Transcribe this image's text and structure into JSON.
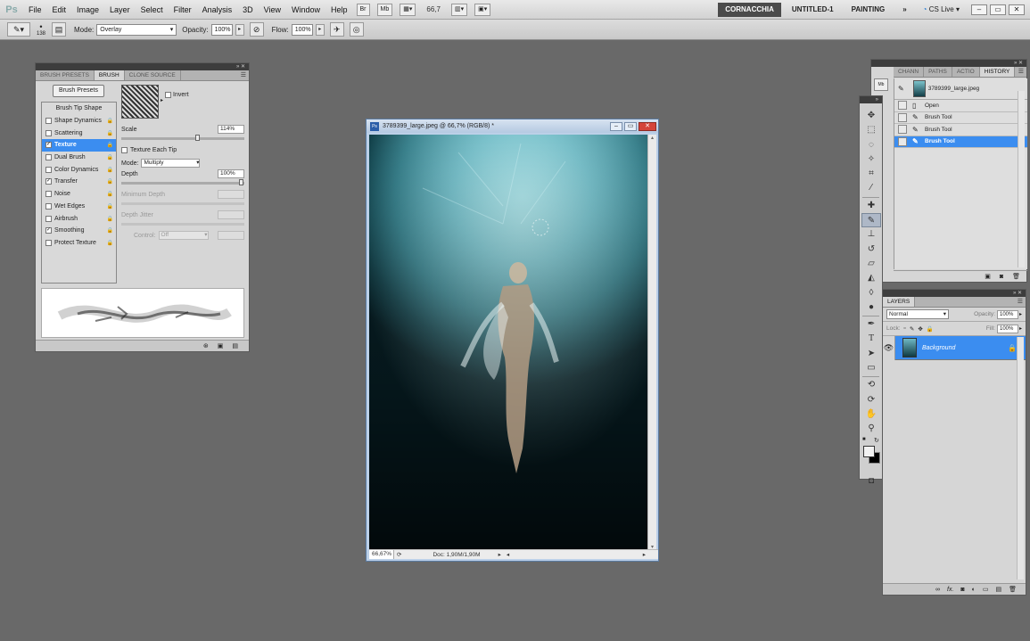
{
  "app": {
    "logo": "Ps"
  },
  "menubar": {
    "items": [
      "File",
      "Edit",
      "Image",
      "Layer",
      "Select",
      "Filter",
      "Analysis",
      "3D",
      "View",
      "Window",
      "Help"
    ],
    "bridge": "Br",
    "minibridge": "Mb",
    "zoom": "66,7",
    "workspaces": [
      "CORNACCHIA",
      "UNTITLED-1",
      "PAINTING"
    ],
    "more": "»",
    "cs_live": "CS Live"
  },
  "optionsbar": {
    "brush_size": "138",
    "mode_label": "Mode:",
    "mode_value": "Overlay",
    "opacity_label": "Opacity:",
    "opacity_value": "100%",
    "flow_label": "Flow:",
    "flow_value": "100%"
  },
  "brush_panel": {
    "tabs": [
      "BRUSH PRESETS",
      "BRUSH",
      "CLONE SOURCE"
    ],
    "presets_button": "Brush Presets",
    "options": [
      {
        "label": "Brush Tip Shape",
        "header": true
      },
      {
        "label": "Shape Dynamics",
        "checked": false
      },
      {
        "label": "Scattering",
        "checked": false
      },
      {
        "label": "Texture",
        "checked": true,
        "selected": true
      },
      {
        "label": "Dual Brush",
        "checked": false
      },
      {
        "label": "Color Dynamics",
        "checked": false
      },
      {
        "label": "Transfer",
        "checked": true
      },
      {
        "label": "Noise",
        "checked": false
      },
      {
        "label": "Wet Edges",
        "checked": false
      },
      {
        "label": "Airbrush",
        "checked": false
      },
      {
        "label": "Smoothing",
        "checked": true
      },
      {
        "label": "Protect Texture",
        "checked": false
      }
    ],
    "invert_label": "Invert",
    "scale_label": "Scale",
    "scale_value": "114%",
    "scale_level": 0.6,
    "texture_each_tip": "Texture Each Tip",
    "mode_label": "Mode:",
    "mode_value": "Multiply",
    "depth_label": "Depth",
    "depth_value": "100%",
    "depth_level": 1.0,
    "min_depth_label": "Minimum Depth",
    "depth_jitter_label": "Depth Jitter",
    "control_label": "Control:",
    "control_value": "Off"
  },
  "document": {
    "title": "3789399_large.jpeg @ 66,7% (RGB/8) *",
    "zoom": "66,67%",
    "doc_info": "Doc: 1,90M/1,90M"
  },
  "history_panel": {
    "tabs": [
      "CHANN",
      "PATHS",
      "ACTIO",
      "HISTORY"
    ],
    "snapshot": "3789399_large.jpeg",
    "states": [
      {
        "label": "Open",
        "selected": false
      },
      {
        "label": "Brush Tool",
        "selected": false
      },
      {
        "label": "Brush Tool",
        "selected": false
      },
      {
        "label": "Brush Tool",
        "selected": true
      }
    ]
  },
  "layers_panel": {
    "tab": "LAYERS",
    "blend_mode": "Normal",
    "opacity_label": "Opacity:",
    "opacity_value": "100%",
    "lock_label": "Lock:",
    "fill_label": "Fill:",
    "fill_value": "100%",
    "layers": [
      {
        "name": "Background",
        "visible": true,
        "locked": true
      }
    ]
  },
  "colors": {
    "selection_blue": "#3b8df0",
    "workspace_gray": "#696969",
    "active_workspace": "#4b4b4b"
  }
}
